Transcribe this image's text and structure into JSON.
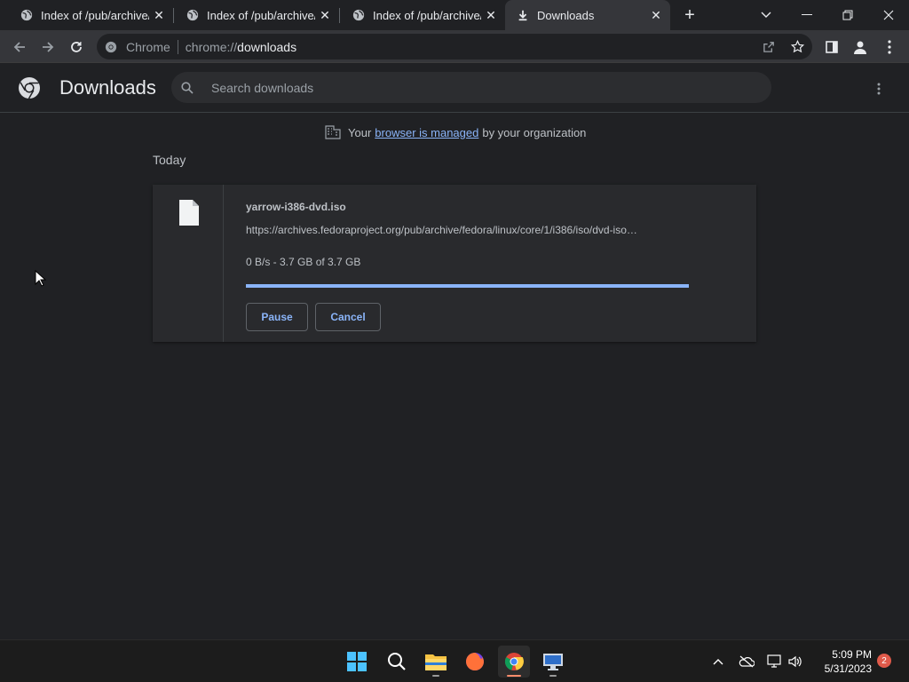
{
  "tabs": [
    {
      "title": "Index of /pub/archive/f",
      "icon": "globe-icon"
    },
    {
      "title": "Index of /pub/archive/f",
      "icon": "globe-icon"
    },
    {
      "title": "Index of /pub/archive/f",
      "icon": "globe-icon"
    },
    {
      "title": "Downloads",
      "icon": "download-icon",
      "active": true
    }
  ],
  "omnibox": {
    "chip": "Chrome",
    "url_scheme": "chrome://",
    "url_host": "downloads"
  },
  "page": {
    "title": "Downloads",
    "search_placeholder": "Search downloads",
    "managed": {
      "prefix": "Your",
      "link": "browser is managed",
      "suffix": "by your organization"
    },
    "section": "Today"
  },
  "download": {
    "filename": "yarrow-i386-dvd.iso",
    "url": "https://archives.fedoraproject.org/pub/archive/fedora/linux/core/1/i386/iso/dvd-iso…",
    "status": "0 B/s - 3.7 GB of 3.7 GB",
    "progress": 1.0,
    "pause_label": "Pause",
    "cancel_label": "Cancel"
  },
  "taskbar": {
    "apps": [
      "start-icon",
      "search-icon",
      "file-explorer-icon",
      "firefox-icon",
      "chrome-icon",
      "remote-desktop-icon"
    ],
    "time": "5:09 PM",
    "date": "5/31/2023",
    "notification_count": "2"
  },
  "colors": {
    "accent": "#8ab4f8",
    "background": "#202124",
    "toolbar": "#35363a"
  }
}
